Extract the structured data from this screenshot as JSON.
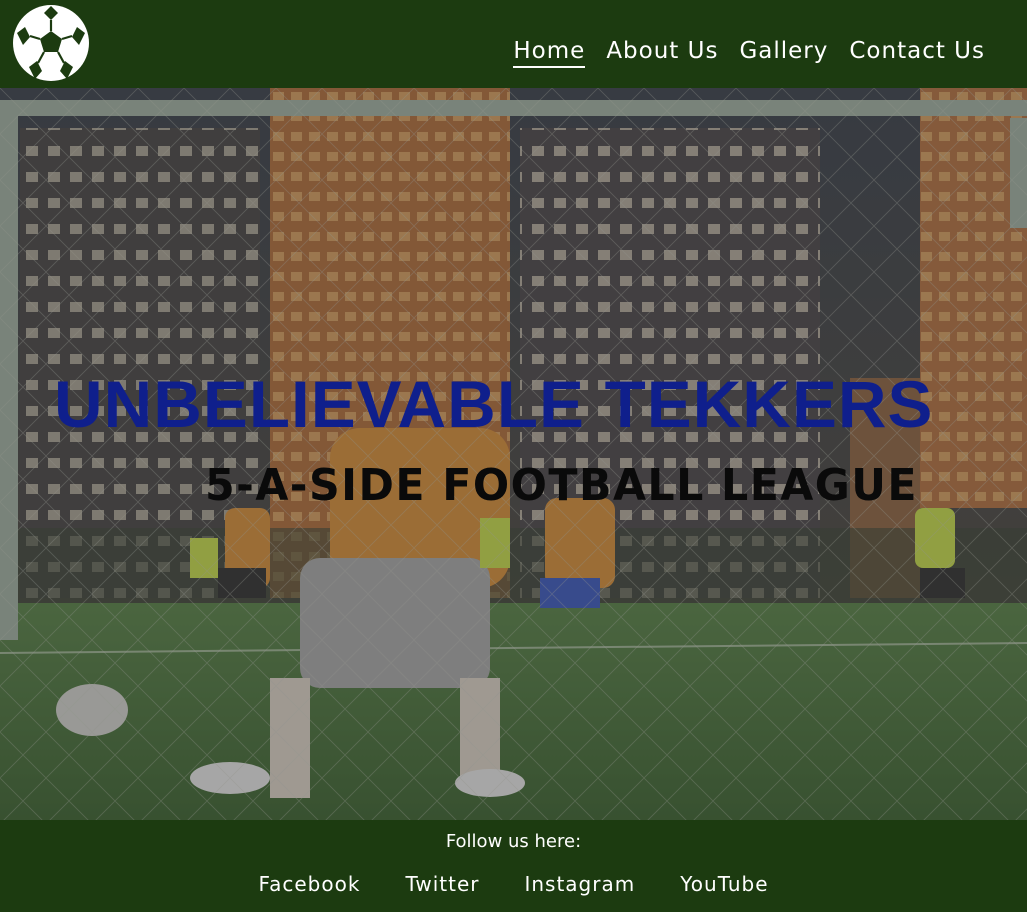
{
  "header": {
    "logo_icon": "soccer-ball-icon",
    "nav": [
      {
        "label": "Home",
        "active": true
      },
      {
        "label": "About Us",
        "active": false
      },
      {
        "label": "Gallery",
        "active": false
      },
      {
        "label": "Contact Us",
        "active": false
      }
    ]
  },
  "hero": {
    "title": "UNBELIEVABLE TEKKERS",
    "subtitle": "5-A-SIDE FOOTBALL LEAGUE",
    "title_color": "#0f1f8c"
  },
  "footer": {
    "follow_label": "Follow us here:",
    "social": [
      "Facebook",
      "Twitter",
      "Instagram",
      "YouTube"
    ]
  },
  "colors": {
    "bar_bg": "#1c3b10",
    "text": "#ffffff"
  }
}
